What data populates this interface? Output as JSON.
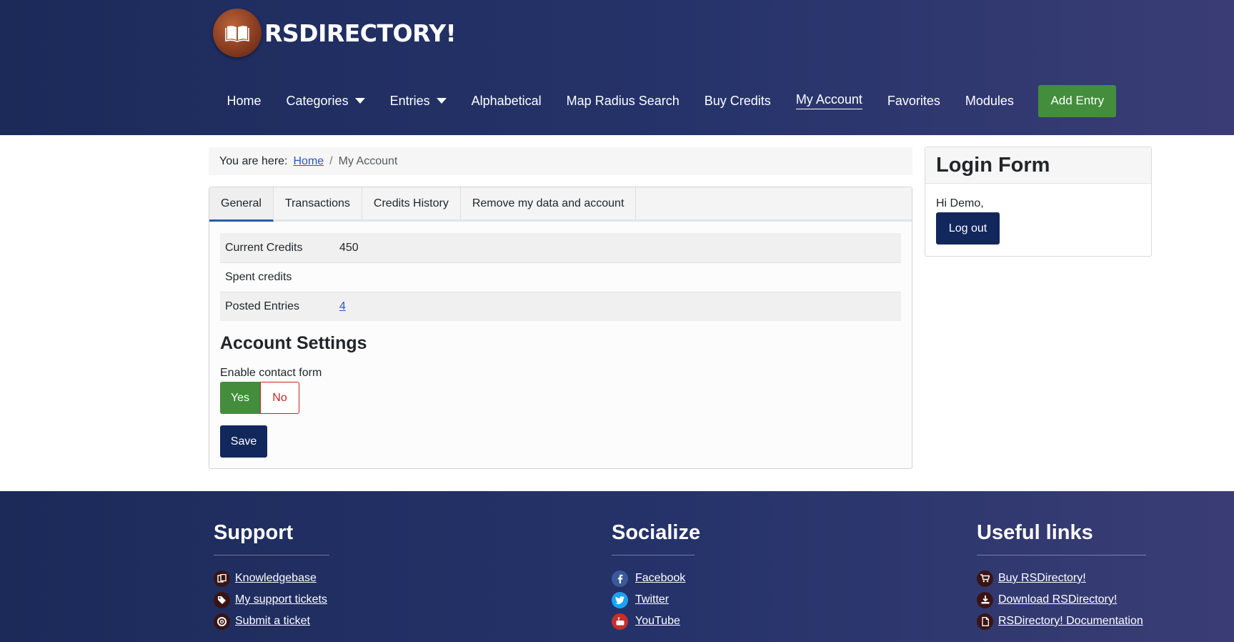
{
  "header": {
    "logo_text": "RSDIRECTORY!",
    "nav": [
      {
        "label": "Home",
        "dropdown": false,
        "active": false
      },
      {
        "label": "Categories",
        "dropdown": true,
        "active": false
      },
      {
        "label": "Entries",
        "dropdown": true,
        "active": false
      },
      {
        "label": "Alphabetical",
        "dropdown": false,
        "active": false
      },
      {
        "label": "Map Radius Search",
        "dropdown": false,
        "active": false
      },
      {
        "label": "Buy Credits",
        "dropdown": false,
        "active": false
      },
      {
        "label": "My Account",
        "dropdown": false,
        "active": true
      },
      {
        "label": "Favorites",
        "dropdown": false,
        "active": false
      },
      {
        "label": "Modules",
        "dropdown": false,
        "active": false
      }
    ],
    "add_entry_label": "Add Entry"
  },
  "breadcrumb": {
    "prefix": "You are here:",
    "home": "Home",
    "separator": "/",
    "current": "My Account"
  },
  "tabs": [
    {
      "label": "General",
      "active": true
    },
    {
      "label": "Transactions",
      "active": false
    },
    {
      "label": "Credits History",
      "active": false
    },
    {
      "label": "Remove my data and account",
      "active": false
    }
  ],
  "stats": [
    {
      "label": "Current Credits",
      "value": "450"
    },
    {
      "label": "Spent credits",
      "value": ""
    },
    {
      "label": "Posted Entries",
      "value": "4"
    }
  ],
  "account_settings": {
    "title": "Account Settings",
    "contact_form_label": "Enable contact form",
    "yes_label": "Yes",
    "no_label": "No",
    "selected": "Yes",
    "save_label": "Save"
  },
  "login_form": {
    "title": "Login Form",
    "greeting": "Hi Demo,",
    "logout_label": "Log out"
  },
  "footer": {
    "support": {
      "title": "Support",
      "links": [
        "Knowledgebase",
        "My support tickets",
        "Submit a ticket"
      ]
    },
    "socialize": {
      "title": "Socialize",
      "links": [
        "Facebook",
        "Twitter",
        "YouTube"
      ]
    },
    "useful_links": {
      "title": "Useful links",
      "links": [
        "Buy RSDirectory!",
        "Download RSDirectory!",
        "RSDirectory! Documentation"
      ]
    }
  },
  "colors": {
    "header_bg": "#1c2a5a",
    "add_entry": "#438d3c",
    "primary_button": "#12275c",
    "no_button": "#c52727",
    "link": "#2a55c7"
  }
}
